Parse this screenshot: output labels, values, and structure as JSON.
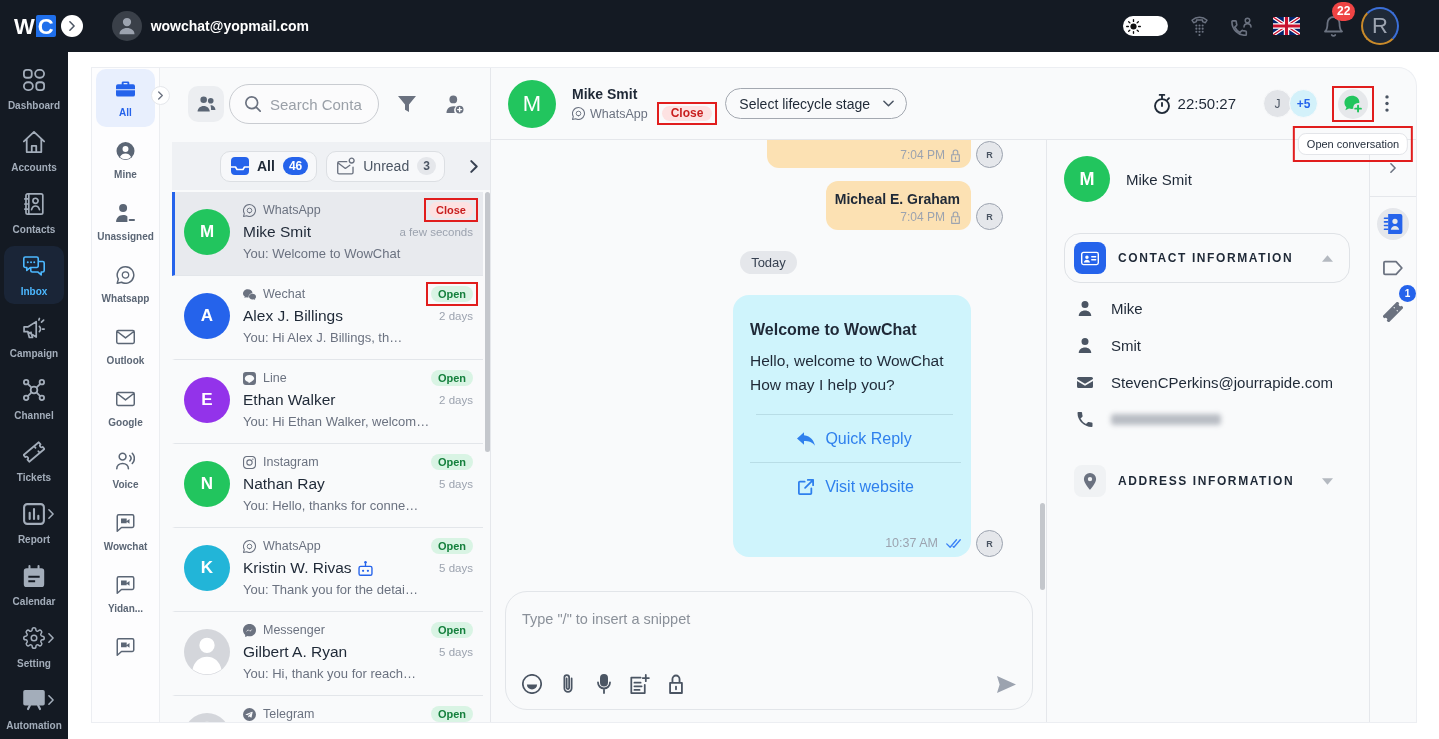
{
  "topbar": {
    "logo": [
      "W",
      "C"
    ],
    "account": {
      "email": "wowchat@yopmail.com"
    },
    "theme_toggle": {
      "on": false
    },
    "notifications": {
      "count": "22"
    },
    "profile": {
      "initial": "R"
    }
  },
  "nav": [
    {
      "label": "Dashboard",
      "selected": false,
      "submenu": false
    },
    {
      "label": "Accounts",
      "selected": false,
      "submenu": false
    },
    {
      "label": "Contacts",
      "selected": false,
      "submenu": false
    },
    {
      "label": "Inbox",
      "selected": true,
      "submenu": false
    },
    {
      "label": "Campaign",
      "selected": false,
      "submenu": false
    },
    {
      "label": "Channel",
      "selected": false,
      "submenu": false
    },
    {
      "label": "Tickets",
      "selected": false,
      "submenu": false
    },
    {
      "label": "Report",
      "selected": false,
      "submenu": true
    },
    {
      "label": "Calendar",
      "selected": false,
      "submenu": false
    },
    {
      "label": "Setting",
      "selected": false,
      "submenu": true
    },
    {
      "label": "Automation",
      "selected": false,
      "submenu": true
    }
  ],
  "folders": [
    {
      "label": "All",
      "selected": true
    },
    {
      "label": "Mine",
      "selected": false
    },
    {
      "label": "Unassigned",
      "selected": false
    },
    {
      "label": "Whatsapp",
      "selected": false
    },
    {
      "label": "Outlook",
      "selected": false
    },
    {
      "label": "Google",
      "selected": false
    },
    {
      "label": "Voice",
      "selected": false
    },
    {
      "label": "Wowchat",
      "selected": false
    },
    {
      "label": "Yidan...",
      "selected": false
    },
    {
      "selected": false
    }
  ],
  "conversations": {
    "search": {
      "placeholder": "Search Conta"
    },
    "filters": [
      {
        "label": "All",
        "count": "46",
        "selected": true
      },
      {
        "label": "Unread",
        "count": "3",
        "selected": false
      }
    ],
    "items": [
      {
        "channel": {
          "label": "WhatsApp",
          "kind": "whatsapp"
        },
        "name": "Mike Smit",
        "bot": false,
        "preview": "You: Welcome to WowChat",
        "status": {
          "label": "Close",
          "kind": "closed"
        },
        "time": "a few seconds",
        "selected": true,
        "highlighted": true,
        "avatar": {
          "kind": "initial",
          "letter": "M",
          "color": "#22c55e"
        }
      },
      {
        "channel": {
          "label": "Wechat",
          "kind": "wechat"
        },
        "name": "Alex J. Billings",
        "bot": false,
        "preview": "You: Hi Alex J. Billings, th…",
        "status": {
          "label": "Open",
          "kind": "open"
        },
        "time": "2 days",
        "selected": false,
        "highlighted": true,
        "avatar": {
          "kind": "initial",
          "letter": "A",
          "color": "#2563eb"
        }
      },
      {
        "channel": {
          "label": "Line",
          "kind": "line"
        },
        "name": "Ethan Walker",
        "bot": false,
        "preview": "You: Hi Ethan Walker, welcom…",
        "status": {
          "label": "Open",
          "kind": "open"
        },
        "time": "2 days",
        "selected": false,
        "highlighted": false,
        "avatar": {
          "kind": "initial",
          "letter": "E",
          "color": "#9333ea"
        }
      },
      {
        "channel": {
          "label": "Instagram",
          "kind": "instagram"
        },
        "name": "Nathan Ray",
        "bot": false,
        "preview": "You: Hello, thanks for conne…",
        "status": {
          "label": "Open",
          "kind": "open"
        },
        "time": "5 days",
        "selected": false,
        "highlighted": false,
        "avatar": {
          "kind": "initial",
          "letter": "N",
          "color": "#22c55e"
        }
      },
      {
        "channel": {
          "label": "WhatsApp",
          "kind": "whatsapp"
        },
        "name": "Kristin W. Rivas",
        "bot": true,
        "preview": "You: Thank you for the detai…",
        "status": {
          "label": "Open",
          "kind": "open"
        },
        "time": "5 days",
        "selected": false,
        "highlighted": false,
        "avatar": {
          "kind": "initial",
          "letter": "K",
          "color": "#22b5d8"
        }
      },
      {
        "channel": {
          "label": "Messenger",
          "kind": "messenger"
        },
        "name": "Gilbert A. Ryan",
        "bot": false,
        "preview": "You: Hi, thank you for reach…",
        "status": {
          "label": "Open",
          "kind": "open"
        },
        "time": "5 days",
        "selected": false,
        "highlighted": false,
        "avatar": {
          "kind": "silhouette"
        }
      },
      {
        "channel": {
          "label": "Telegram",
          "kind": "telegram"
        },
        "bot": false,
        "status": {
          "label": "Open",
          "kind": "open"
        },
        "selected": false,
        "highlighted": false,
        "avatar": {
          "kind": "silhouette"
        }
      }
    ]
  },
  "chat": {
    "header": {
      "avatar": {
        "letter": "M",
        "color": "#22c55e"
      },
      "name": "Mike Smit",
      "channel": {
        "label": "WhatsApp",
        "kind": "whatsapp"
      },
      "status": {
        "label": "Close",
        "kind": "closed",
        "highlighted": true
      },
      "lifecycle": {
        "placeholder": "Select lifecycle stage"
      },
      "timer": "22:50:27",
      "participants": [
        {
          "label": "J",
          "kind": "agent"
        },
        {
          "label": "+5",
          "kind": "more"
        }
      ],
      "open_conversation": {
        "highlighted": true,
        "tooltip": {
          "text": "Open conversation",
          "highlighted": true
        }
      }
    },
    "messages": [
      {
        "kind": "outgoing",
        "time": "7:04 PM",
        "private": true,
        "sender": "R"
      },
      {
        "kind": "outgoing",
        "text": "Micheal E. Graham",
        "time": "7:04 PM",
        "private": true,
        "sender": "R"
      },
      {
        "kind": "date",
        "text": "Today"
      },
      {
        "kind": "template",
        "title": "Welcome to WowChat",
        "body": "Hello, welcome to WowChat\nHow may I help you?",
        "buttons": [
          {
            "label": "Quick Reply",
            "kind": "reply"
          },
          {
            "label": "Visit website",
            "kind": "link"
          }
        ],
        "time": "10:37 AM",
        "read": true,
        "sender": "R"
      }
    ],
    "composer": {
      "placeholder": "Type \"/\" to insert a snippet"
    }
  },
  "contact": {
    "avatar": {
      "letter": "M",
      "color": "#22c55e"
    },
    "name": "Mike Smit",
    "sections": [
      {
        "title": "CONTACT INFORMATION",
        "kind": "contact",
        "expanded": true,
        "fields": [
          {
            "kind": "first_name",
            "value": "Mike"
          },
          {
            "kind": "last_name",
            "value": "Smit"
          },
          {
            "kind": "email",
            "value": "StevenCPerkins@jourrapide.com"
          },
          {
            "kind": "phone",
            "redacted": true
          }
        ]
      },
      {
        "title": "ADDRESS INFORMATION",
        "kind": "address",
        "expanded": false
      }
    ]
  },
  "rail": [
    {
      "kind": "contact",
      "selected": true
    },
    {
      "kind": "tags",
      "selected": false
    },
    {
      "kind": "tickets",
      "selected": false,
      "badge": "1"
    }
  ]
}
